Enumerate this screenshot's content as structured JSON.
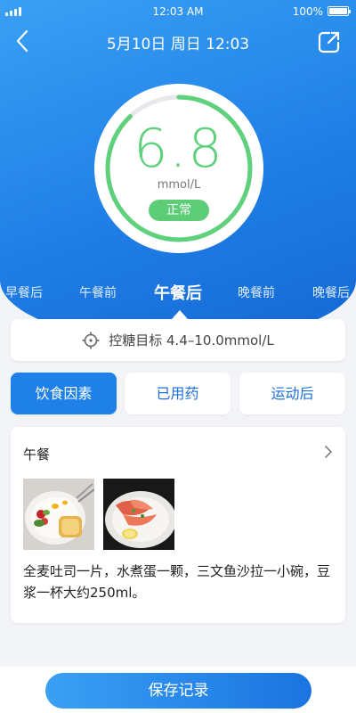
{
  "status_bar": {
    "time": "12:03 AM",
    "battery": "100%"
  },
  "nav": {
    "title": "5月10日 周日 12:03"
  },
  "gauge": {
    "value": "6.8",
    "unit": "mmol/L",
    "status": "正常",
    "level": 0.88,
    "accent": "#5fd07b"
  },
  "meal_tabs": [
    {
      "label": "早餐后"
    },
    {
      "label": "午餐前"
    },
    {
      "label": "午餐后",
      "active": true
    },
    {
      "label": "晚餐前"
    },
    {
      "label": "晚餐后"
    }
  ],
  "target": {
    "label": "控糖目标 4.4–10.0mmol/L"
  },
  "factor_tabs": [
    {
      "label": "饮食因素",
      "active": true
    },
    {
      "label": "已用药"
    },
    {
      "label": "运动后"
    }
  ],
  "meal_card": {
    "title": "午餐",
    "description": "全麦吐司一片，水煮蛋一颗，三文鱼沙拉一小碗，豆浆一杯大约250ml。"
  },
  "save_button": {
    "label": "保存记录"
  },
  "colors": {
    "primary": "#1f80e8",
    "normal": "#5dcc77"
  }
}
